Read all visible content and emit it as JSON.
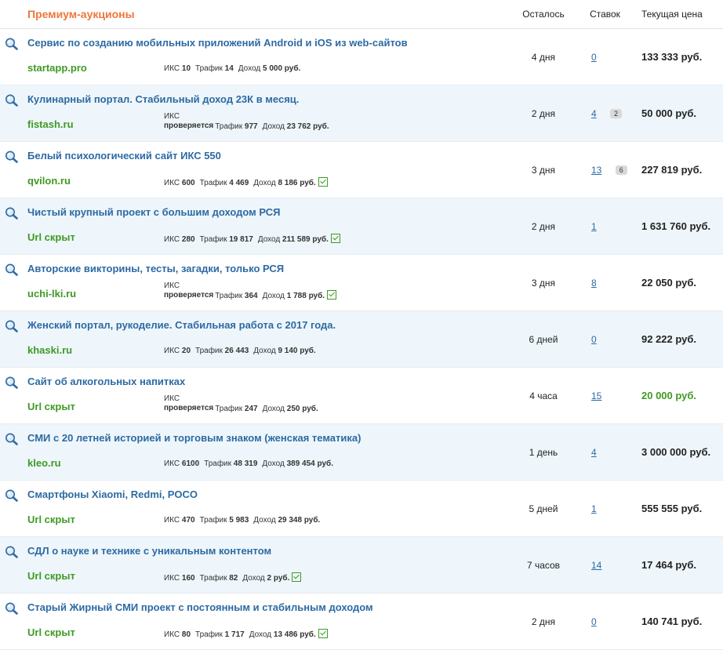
{
  "header": {
    "title": "Премиум-аукционы",
    "col_left": "Осталось",
    "col_bids": "Ставок",
    "col_price": "Текущая цена"
  },
  "labels": {
    "iks": "ИКС",
    "traffic": "Трафик",
    "income": "Доход",
    "checking": "проверяется"
  },
  "lots": [
    {
      "title": "Сервис по созданию мобильных приложений Android и iOS из web-сайтов",
      "domain": "startapp.pro",
      "iks": "10",
      "traffic": "14",
      "income": "5 000 руб.",
      "verified": false,
      "time_left": "4 дня",
      "bids": "0",
      "comments": "",
      "price": "133 333 руб.",
      "price_green": false
    },
    {
      "title": "Кулинарный портал. Стабильный доход 23К в месяц.",
      "domain": "fistash.ru",
      "iks": "",
      "traffic": "977",
      "income": "23 762 руб.",
      "verified": false,
      "time_left": "2 дня",
      "bids": "4",
      "comments": "2",
      "price": "50 000 руб.",
      "price_green": false
    },
    {
      "title": "Белый психологический сайт ИКС 550",
      "domain": "qvilon.ru",
      "iks": "600",
      "traffic": "4 469",
      "income": "8 186 руб.",
      "verified": true,
      "time_left": "3 дня",
      "bids": "13",
      "comments": "6",
      "price": "227 819 руб.",
      "price_green": false
    },
    {
      "title": "Чистый крупный проект с большим доходом РСЯ",
      "domain": "Url скрыт",
      "iks": "280",
      "traffic": "19 817",
      "income": "211 589 руб.",
      "verified": true,
      "time_left": "2 дня",
      "bids": "1",
      "comments": "",
      "price": "1 631 760 руб.",
      "price_green": false
    },
    {
      "title": "Авторские викторины, тесты, загадки, только РСЯ",
      "domain": "uchi-lki.ru",
      "iks": "",
      "traffic": "364",
      "income": "1 788 руб.",
      "verified": true,
      "time_left": "3 дня",
      "bids": "8",
      "comments": "",
      "price": "22 050 руб.",
      "price_green": false
    },
    {
      "title": "Женский портал, рукоделие. Стабильная работа с 2017 года.",
      "domain": "khaski.ru",
      "iks": "20",
      "traffic": "26 443",
      "income": "9 140 руб.",
      "verified": false,
      "time_left": "6 дней",
      "bids": "0",
      "comments": "",
      "price": "92 222 руб.",
      "price_green": false
    },
    {
      "title": "Сайт об алкогольных напитках",
      "domain": "Url скрыт",
      "iks": "",
      "traffic": "247",
      "income": "250 руб.",
      "verified": false,
      "time_left": "4 часа",
      "bids": "15",
      "comments": "",
      "price": "20 000 руб.",
      "price_green": true
    },
    {
      "title": "СМИ с 20 летней историей и торговым знаком (женская тематика)",
      "domain": "kleo.ru",
      "iks": "6100",
      "traffic": "48 319",
      "income": "389 454 руб.",
      "verified": false,
      "time_left": "1 день",
      "bids": "4",
      "comments": "",
      "price": "3 000 000 руб.",
      "price_green": false
    },
    {
      "title": "Смартфоны Xiaomi, Redmi, POCO",
      "domain": "Url скрыт",
      "iks": "470",
      "traffic": "5 983",
      "income": "29 348 руб.",
      "verified": false,
      "time_left": "5 дней",
      "bids": "1",
      "comments": "",
      "price": "555 555 руб.",
      "price_green": false
    },
    {
      "title": "СДЛ о науке и технике с уникальным контентом",
      "domain": "Url скрыт",
      "iks": "160",
      "traffic": "82",
      "income": "2 руб.",
      "verified": true,
      "time_left": "7 часов",
      "bids": "14",
      "comments": "",
      "price": "17 464 руб.",
      "price_green": false
    },
    {
      "title": "Старый Жирный СМИ проект с постоянным и стабильным доходом",
      "domain": "Url скрыт",
      "iks": "80",
      "traffic": "1 717",
      "income": "13 486 руб.",
      "verified": true,
      "time_left": "2 дня",
      "bids": "0",
      "comments": "",
      "price": "140 741 руб.",
      "price_green": false
    }
  ]
}
